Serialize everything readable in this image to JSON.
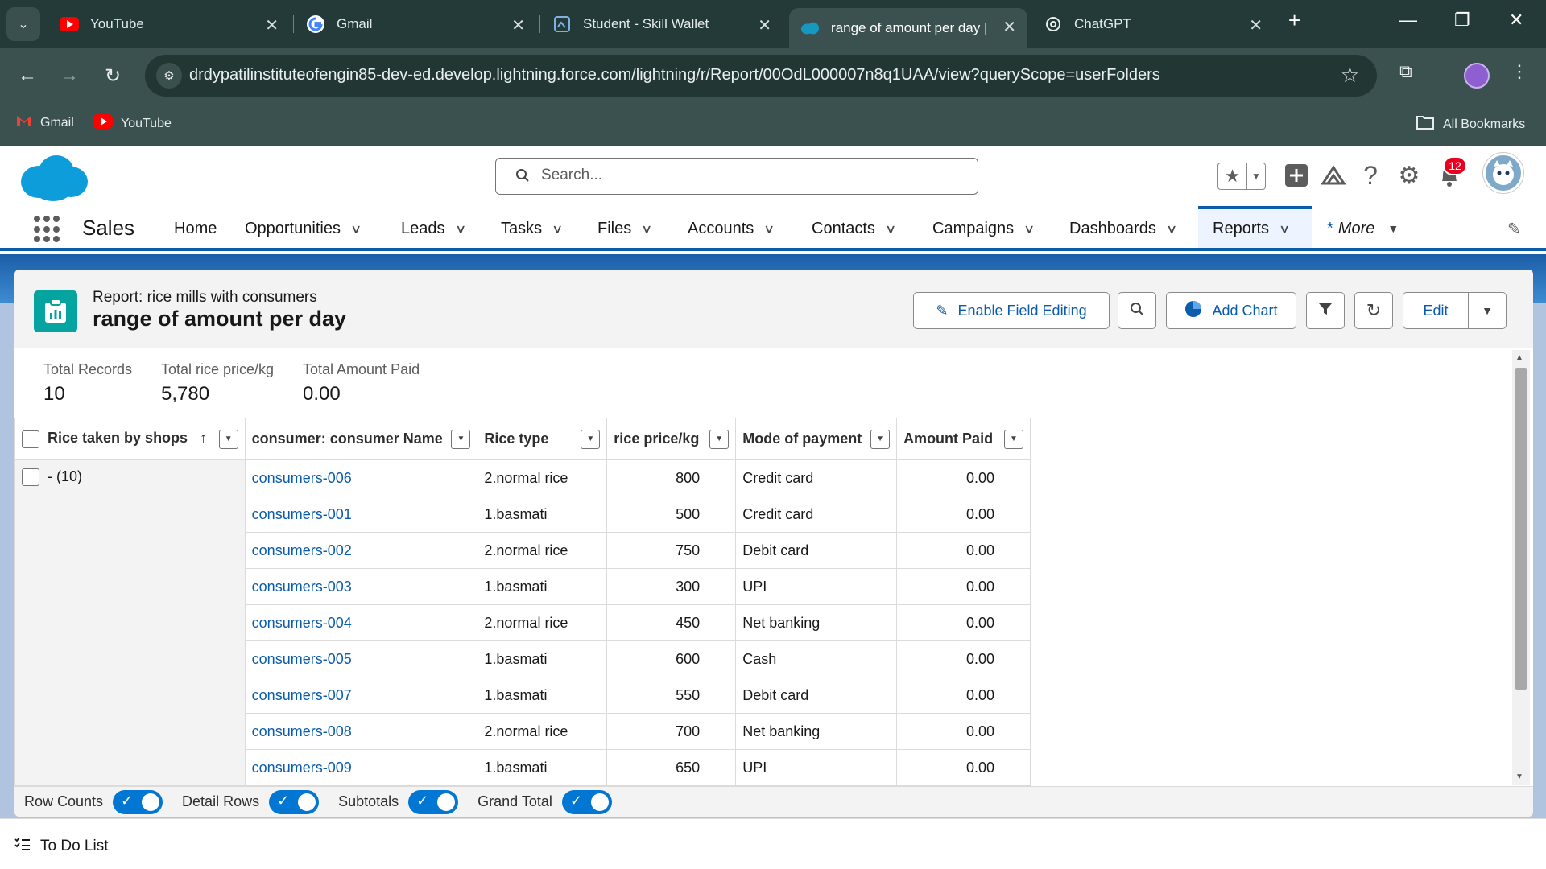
{
  "browser": {
    "tabs": [
      {
        "title": "YouTube",
        "icon": "youtube-icon"
      },
      {
        "title": "Gmail",
        "icon": "google-icon"
      },
      {
        "title": "Student - Skill Wallet",
        "icon": "skill-wallet-icon"
      },
      {
        "title": "range of amount per day | S",
        "icon": "salesforce-cloud-icon",
        "active": true
      },
      {
        "title": "ChatGPT",
        "icon": "chatgpt-icon"
      }
    ],
    "url": "drdypatilinstituteofengin85-dev-ed.develop.lightning.force.com/lightning/r/Report/00OdL000007n8q1UAA/view?queryScope=userFolders",
    "bookmarks": [
      {
        "label": "Gmail",
        "icon": "gmail-icon"
      },
      {
        "label": "YouTube",
        "icon": "youtube-icon"
      }
    ],
    "all_bookmarks": "All Bookmarks"
  },
  "sf_header": {
    "search_placeholder": "Search...",
    "notification_count": "12"
  },
  "nav": {
    "app_name": "Sales",
    "items": [
      {
        "label": "Home",
        "has_menu": false
      },
      {
        "label": "Opportunities",
        "has_menu": true
      },
      {
        "label": "Leads",
        "has_menu": true
      },
      {
        "label": "Tasks",
        "has_menu": true
      },
      {
        "label": "Files",
        "has_menu": true
      },
      {
        "label": "Accounts",
        "has_menu": true
      },
      {
        "label": "Contacts",
        "has_menu": true
      },
      {
        "label": "Campaigns",
        "has_menu": true
      },
      {
        "label": "Dashboards",
        "has_menu": true
      },
      {
        "label": "Reports",
        "has_menu": true,
        "active": true
      }
    ],
    "more_star": "*",
    "more_label": "More"
  },
  "report": {
    "subtitle": "Report: rice mills with consumers",
    "title": "range of amount per day",
    "buttons": {
      "enable_field_editing": "Enable Field Editing",
      "add_chart": "Add Chart",
      "edit": "Edit"
    },
    "summary": [
      {
        "label": "Total Records",
        "value": "10"
      },
      {
        "label": "Total rice price/kg",
        "value": "5,780"
      },
      {
        "label": "Total Amount Paid",
        "value": "0.00"
      }
    ],
    "columns": [
      "Rice taken by shops",
      "consumer: consumer Name",
      "Rice type",
      "rice price/kg",
      "Mode of payment",
      "Amount Paid"
    ],
    "sort_arrow": "↑",
    "group_label": "- (10)",
    "rows": [
      {
        "name": "consumers-006",
        "rice_type": "2.normal rice",
        "price": "800",
        "mode": "Credit card",
        "paid": "0.00"
      },
      {
        "name": "consumers-001",
        "rice_type": "1.basmati",
        "price": "500",
        "mode": "Credit card",
        "paid": "0.00"
      },
      {
        "name": "consumers-002",
        "rice_type": "2.normal rice",
        "price": "750",
        "mode": "Debit card",
        "paid": "0.00"
      },
      {
        "name": "consumers-003",
        "rice_type": "1.basmati",
        "price": "300",
        "mode": "UPI",
        "paid": "0.00"
      },
      {
        "name": "consumers-004",
        "rice_type": "2.normal rice",
        "price": "450",
        "mode": "Net banking",
        "paid": "0.00"
      },
      {
        "name": "consumers-005",
        "rice_type": "1.basmati",
        "price": "600",
        "mode": "Cash",
        "paid": "0.00"
      },
      {
        "name": "consumers-007",
        "rice_type": "1.basmati",
        "price": "550",
        "mode": "Debit card",
        "paid": "0.00"
      },
      {
        "name": "consumers-008",
        "rice_type": "2.normal rice",
        "price": "700",
        "mode": "Net banking",
        "paid": "0.00"
      },
      {
        "name": "consumers-009",
        "rice_type": "1.basmati",
        "price": "650",
        "mode": "UPI",
        "paid": "0.00"
      }
    ],
    "toggles": [
      {
        "label": "Row Counts",
        "on": true
      },
      {
        "label": "Detail Rows",
        "on": true
      },
      {
        "label": "Subtotals",
        "on": true
      },
      {
        "label": "Grand Total",
        "on": true
      }
    ]
  },
  "utility": {
    "todo_label": "To Do List"
  },
  "colors": {
    "brand": "#0b5cab",
    "chrome_dark": "#233a38",
    "report_icon": "#05a4a0",
    "badge": "#ea001e"
  }
}
